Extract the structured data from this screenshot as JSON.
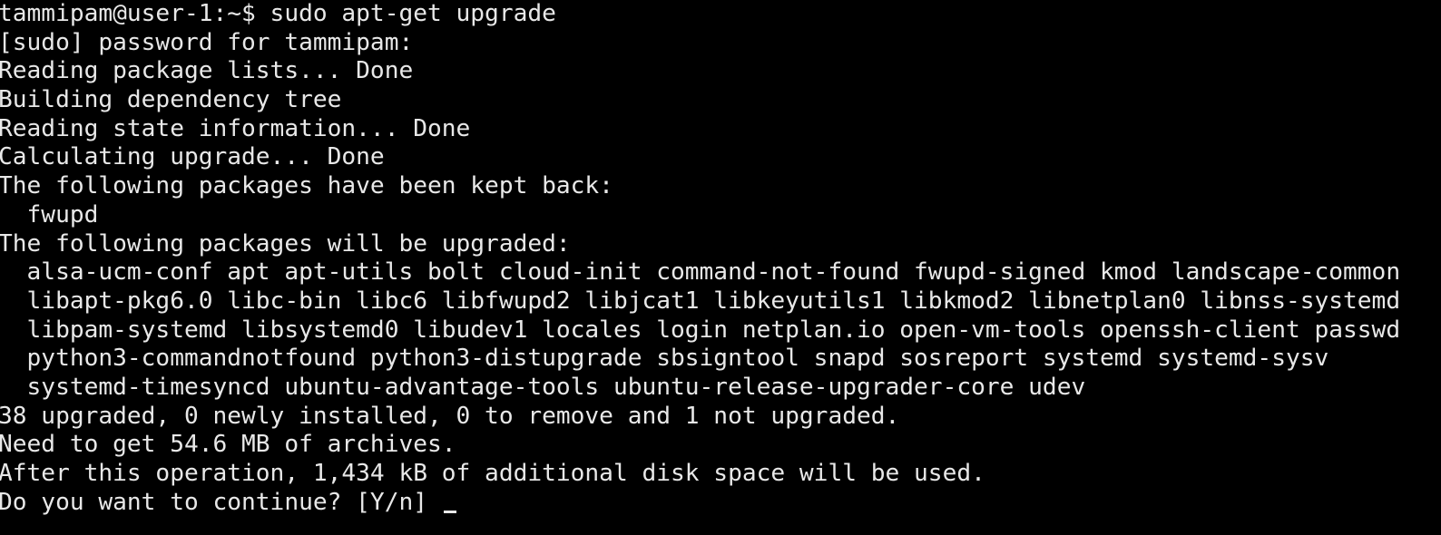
{
  "terminal": {
    "lines": [
      "tammipam@user-1:~$ sudo apt-get upgrade",
      "[sudo] password for tammipam:",
      "Reading package lists... Done",
      "Building dependency tree",
      "Reading state information... Done",
      "Calculating upgrade... Done",
      "The following packages have been kept back:",
      "  fwupd",
      "The following packages will be upgraded:",
      "  alsa-ucm-conf apt apt-utils bolt cloud-init command-not-found fwupd-signed kmod landscape-common",
      "  libapt-pkg6.0 libc-bin libc6 libfwupd2 libjcat1 libkeyutils1 libkmod2 libnetplan0 libnss-systemd",
      "  libpam-systemd libsystemd0 libudev1 locales login netplan.io open-vm-tools openssh-client passwd",
      "  python3-commandnotfound python3-distupgrade sbsigntool snapd sosreport systemd systemd-sysv",
      "  systemd-timesyncd ubuntu-advantage-tools ubuntu-release-upgrader-core udev",
      "38 upgraded, 0 newly installed, 0 to remove and 1 not upgraded.",
      "Need to get 54.6 MB of archives.",
      "After this operation, 1,434 kB of additional disk space will be used.",
      "Do you want to continue? [Y/n] "
    ],
    "colors": {
      "background": "#000000",
      "foreground": "#e8e8e8"
    }
  }
}
